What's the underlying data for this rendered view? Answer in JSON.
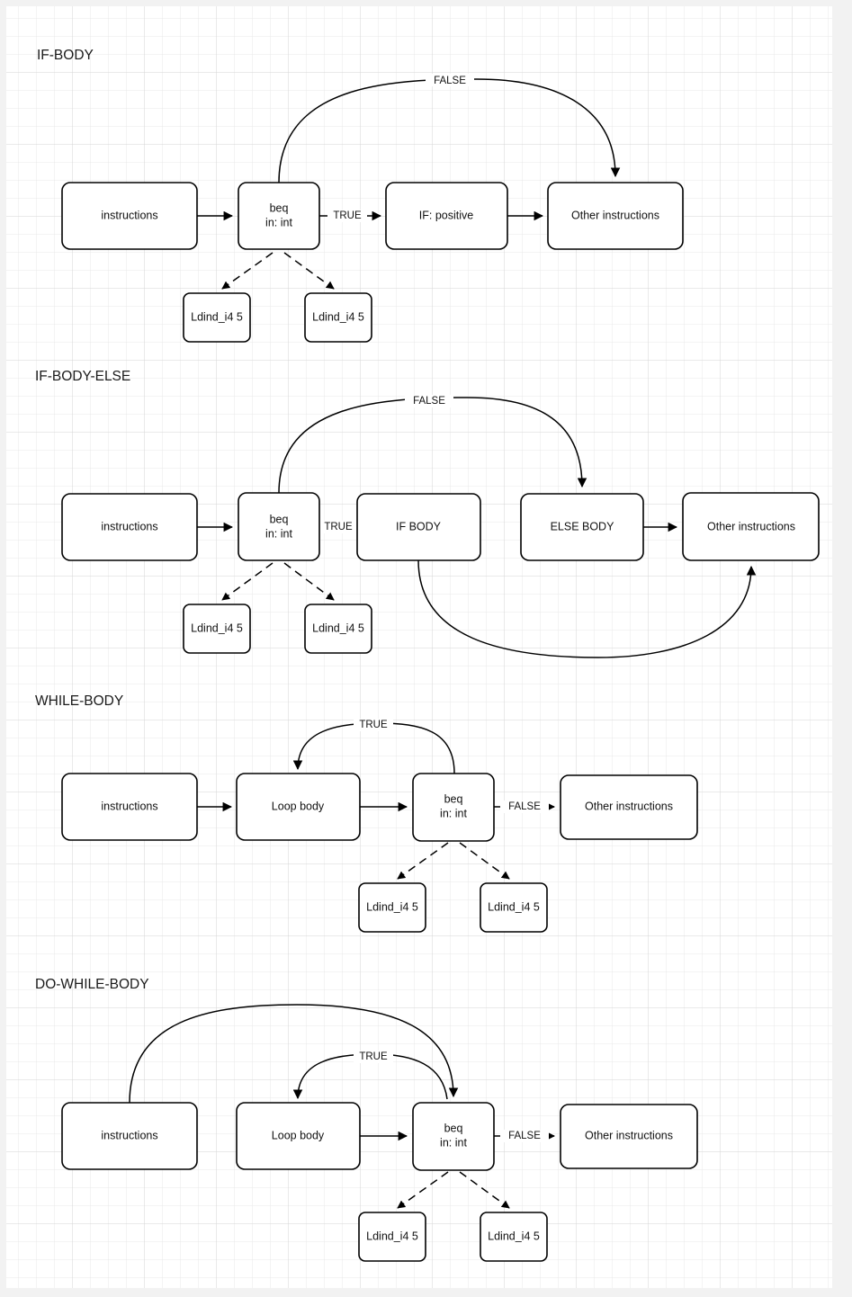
{
  "page": {
    "background": "#f2f2f2",
    "canvas_background": "#ffffff",
    "grid_minor_color": "#e8e8e8",
    "grid_major_color": "#d4d4d4",
    "line_color": "#000000",
    "text_color": "#111111"
  },
  "sections": [
    {
      "id": "if-body",
      "title": "IF-BODY",
      "nodes": {
        "instructions": "instructions",
        "beq_line1": "beq",
        "beq_line2": "in: int",
        "if_positive": "IF: positive",
        "other": "Other instructions",
        "ldind_left": "Ldind_i4 5",
        "ldind_right": "Ldind_i4 5"
      },
      "edges": {
        "false": "FALSE",
        "true": "TRUE"
      }
    },
    {
      "id": "if-body-else",
      "title": "IF-BODY-ELSE",
      "nodes": {
        "instructions": "instructions",
        "beq_line1": "beq",
        "beq_line2": "in: int",
        "if_body": "IF BODY",
        "else_body": "ELSE BODY",
        "other": "Other instructions",
        "ldind_left": "Ldind_i4 5",
        "ldind_right": "Ldind_i4 5"
      },
      "edges": {
        "false": "FALSE",
        "true": "TRUE"
      }
    },
    {
      "id": "while-body",
      "title": "WHILE-BODY",
      "nodes": {
        "instructions": "instructions",
        "loop_body": "Loop body",
        "beq_line1": "beq",
        "beq_line2": "in: int",
        "other": "Other instructions",
        "ldind_left": "Ldind_i4 5",
        "ldind_right": "Ldind_i4 5"
      },
      "edges": {
        "true": "TRUE",
        "false": "FALSE"
      }
    },
    {
      "id": "do-while-body",
      "title": "DO-WHILE-BODY",
      "nodes": {
        "instructions": "instructions",
        "loop_body": "Loop body",
        "beq_line1": "beq",
        "beq_line2": "in: int",
        "other": "Other instructions",
        "ldind_left": "Ldind_i4 5",
        "ldind_right": "Ldind_i4 5"
      },
      "edges": {
        "true": "TRUE",
        "false": "FALSE"
      }
    }
  ]
}
